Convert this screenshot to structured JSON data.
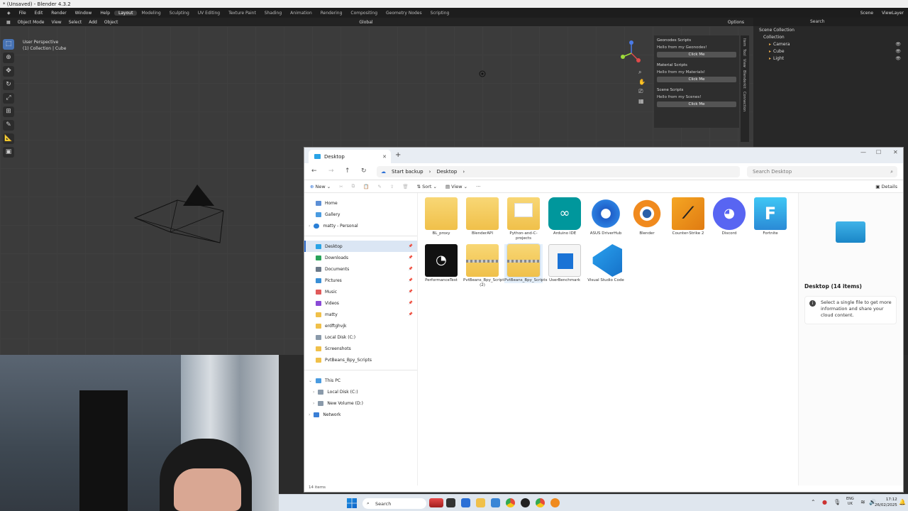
{
  "blender": {
    "title": "* (Unsaved) - Blender 4.3.2",
    "menus": [
      "File",
      "Edit",
      "Render",
      "Window",
      "Help"
    ],
    "workspaces": [
      "Layout",
      "Modeling",
      "Sculpting",
      "UV Editing",
      "Texture Paint",
      "Shading",
      "Animation",
      "Rendering",
      "Compositing",
      "Geometry Nodes",
      "Scripting"
    ],
    "active_workspace": "Layout",
    "header": {
      "mode": "Object Mode",
      "items": [
        "View",
        "Select",
        "Add",
        "Object"
      ],
      "transform": "Global",
      "options": "Options"
    },
    "scene": "Scene",
    "view_layer": "ViewLayer",
    "viewport_info": {
      "line1": "User Perspective",
      "line2": "(1) Collection | Cube"
    },
    "npanel": [
      {
        "title": "Geonodes Scripts",
        "text": "Hello from my Geonodes!",
        "button": "Click Me"
      },
      {
        "title": "Material Scripts",
        "text": "Hello from my Materials!",
        "button": "Click Me"
      },
      {
        "title": "Scene Scripts",
        "text": "Hello from my Scenes!",
        "button": "Click Me"
      }
    ],
    "side_tabs": [
      "Item",
      "Tool",
      "View",
      "Blenderkit",
      "Connection"
    ],
    "outliner": {
      "search_placeholder": "Search",
      "root": "Scene Collection",
      "collection": "Collection",
      "items": [
        "Camera",
        "Cube",
        "Light"
      ]
    }
  },
  "explorer": {
    "tab_title": "Desktop",
    "breadcrumb": [
      "Start backup",
      "Desktop"
    ],
    "search_placeholder": "Search Desktop",
    "commands": {
      "new": "New",
      "sort": "Sort",
      "view": "View",
      "details": "Details"
    },
    "nav": {
      "quick": [
        {
          "label": "Home"
        },
        {
          "label": "Gallery"
        },
        {
          "label": "matty - Personal"
        }
      ],
      "pinned": [
        {
          "label": "Desktop",
          "selected": true
        },
        {
          "label": "Downloads"
        },
        {
          "label": "Documents"
        },
        {
          "label": "Pictures"
        },
        {
          "label": "Music"
        },
        {
          "label": "Videos"
        },
        {
          "label": "matty"
        },
        {
          "label": "erdftghvjk"
        },
        {
          "label": "Local Disk (C:)"
        },
        {
          "label": "Screenshots"
        },
        {
          "label": "PvtBeans_Bpy_Scripts"
        }
      ],
      "this_pc": "This PC",
      "drives": [
        "Local Disk (C:)",
        "New Volume (D:)"
      ],
      "network": "Network"
    },
    "files": [
      {
        "name": "BL_proxy",
        "icon": "folder"
      },
      {
        "name": "BlenderAPI",
        "icon": "folder"
      },
      {
        "name": "Python-and-C-projects",
        "icon": "folder-docs"
      },
      {
        "name": "Arduino IDE",
        "icon": "arduino-icon"
      },
      {
        "name": "ASUS DriverHub",
        "icon": "asus-icon"
      },
      {
        "name": "Blender",
        "icon": "blender-icon"
      },
      {
        "name": "Counter-Strike 2",
        "icon": "cs2-icon"
      },
      {
        "name": "Discord",
        "icon": "discord-icon"
      },
      {
        "name": "Fortnite",
        "icon": "fortnite-icon"
      },
      {
        "name": "PerformanceTest",
        "icon": "perftest-icon"
      },
      {
        "name": "PvtBeans_Bpy_Scripts (2)",
        "icon": "zip-folder"
      },
      {
        "name": "PvtBeans_Bpy_Scripts",
        "icon": "zip-folder"
      },
      {
        "name": "UserBenchmark",
        "icon": "userbenchmark-icon"
      },
      {
        "name": "Visual Studio Code",
        "icon": "vscode-icon"
      }
    ],
    "details_title": "Desktop (14 items)",
    "details_info": "Select a single file to get more information and share your cloud content.",
    "status": "14 items"
  },
  "taskbar": {
    "search": "Search",
    "lang": "ENG\nUK",
    "time": "17:12",
    "date": "26/02/2025"
  }
}
